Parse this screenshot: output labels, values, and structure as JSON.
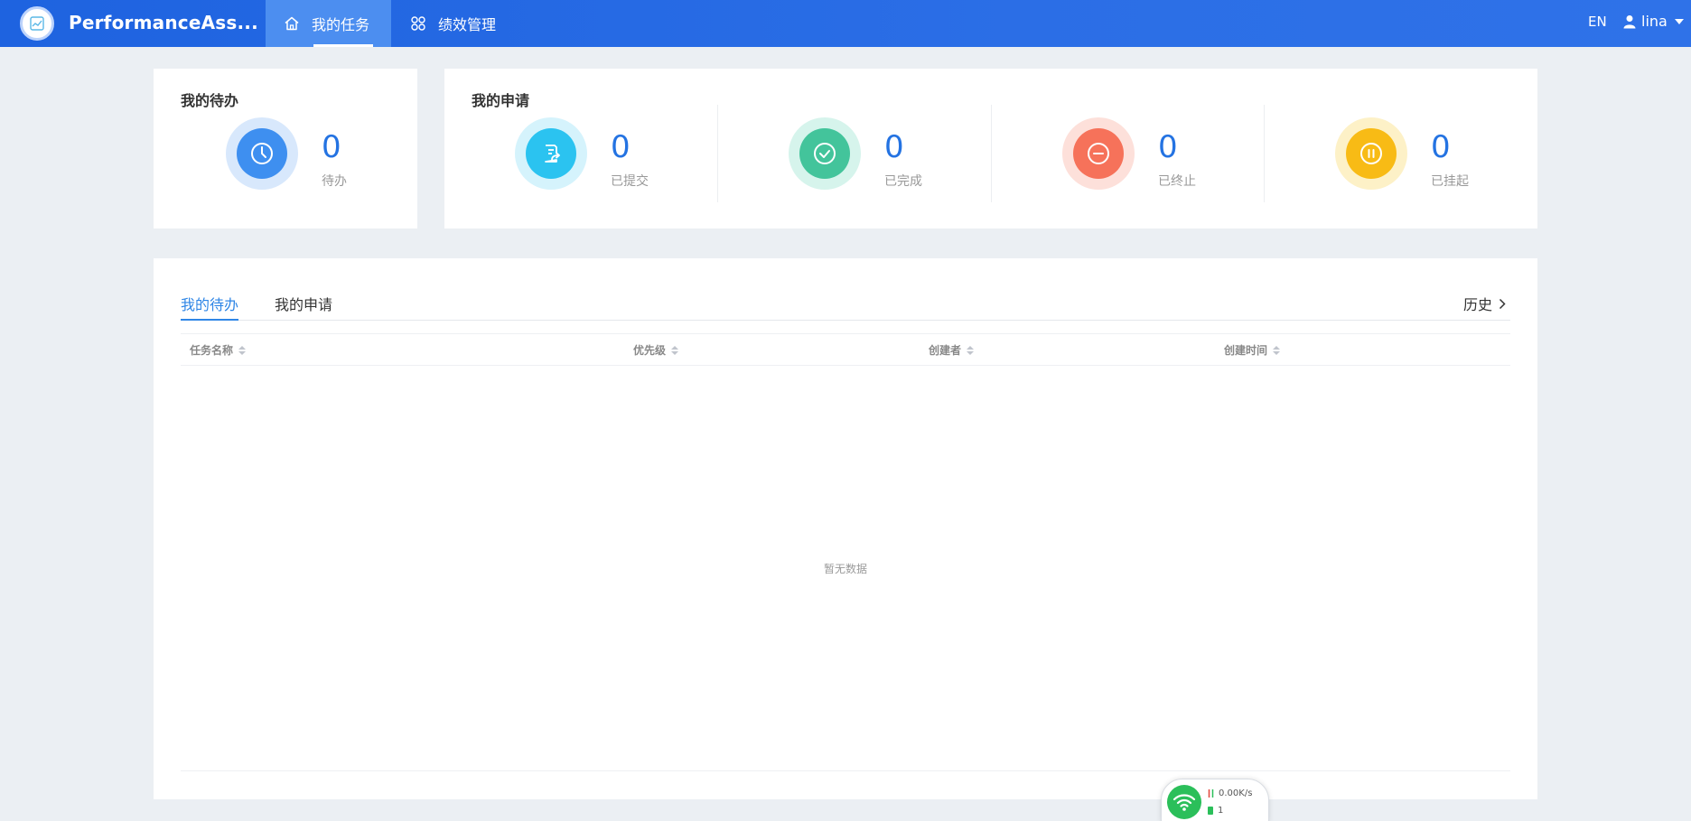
{
  "header": {
    "app_name": "PerformanceAss...",
    "nav": [
      {
        "label": "我的任务",
        "icon": "home-icon",
        "active": true
      },
      {
        "label": "绩效管理",
        "icon": "apps-icon",
        "active": false
      }
    ],
    "lang": "EN",
    "user": "lina"
  },
  "todo_card": {
    "title": "我的待办",
    "stat": {
      "value": "0",
      "label": "待办",
      "icon": "clock-icon",
      "color": "#3e8ff0"
    }
  },
  "apply_card": {
    "title": "我的申请",
    "stats": [
      {
        "value": "0",
        "label": "已提交",
        "icon": "submit-doc-icon",
        "color": "#2bc3f0"
      },
      {
        "value": "0",
        "label": "已完成",
        "icon": "check-circle-icon",
        "color": "#43c49b"
      },
      {
        "value": "0",
        "label": "已终止",
        "icon": "minus-circle-icon",
        "color": "#f6725a"
      },
      {
        "value": "0",
        "label": "已挂起",
        "icon": "pause-circle-icon",
        "color": "#f8bb15"
      }
    ]
  },
  "panel": {
    "tabs": [
      {
        "label": "我的待办",
        "active": true
      },
      {
        "label": "我的申请",
        "active": false
      }
    ],
    "history_label": "历史",
    "columns": [
      "任务名称",
      "优先级",
      "创建者",
      "创建时间"
    ],
    "empty_text": "暂无数据"
  },
  "network_widget": {
    "speed": "0.00K/s",
    "count": "1"
  },
  "colors": {
    "accent": "#2f86e6",
    "topbar": "#1e63e0",
    "number": "#2473e2"
  }
}
